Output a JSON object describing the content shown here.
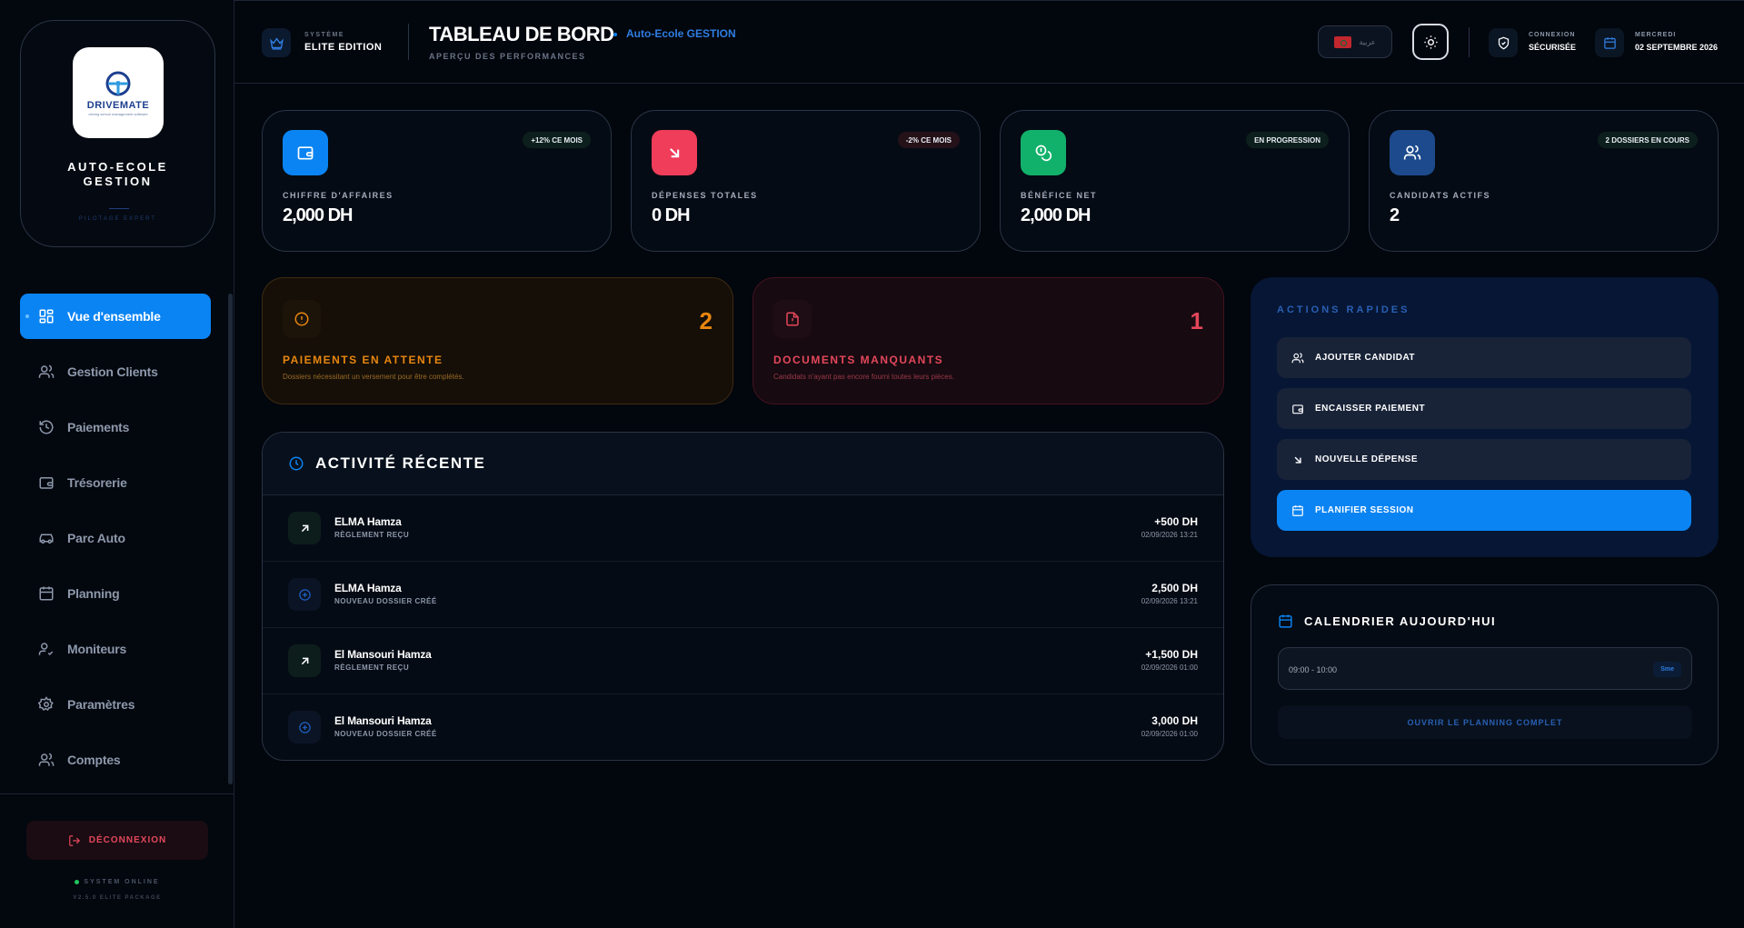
{
  "sidebar": {
    "brand": {
      "logo_text": "DRIVEMATE",
      "logo_subtext": "driving school management software",
      "title_line1": "AUTO-ECOLE",
      "title_line2": "GESTION",
      "tagline": "PILOTAGE EXPERT"
    },
    "nav": [
      {
        "label": "Vue d'ensemble",
        "icon": "grid-icon",
        "active": true
      },
      {
        "label": "Gestion Clients",
        "icon": "users-icon",
        "active": false
      },
      {
        "label": "Paiements",
        "icon": "history-icon",
        "active": false
      },
      {
        "label": "Trésorerie",
        "icon": "wallet-icon",
        "active": false
      },
      {
        "label": "Parc Auto",
        "icon": "car-icon",
        "active": false
      },
      {
        "label": "Planning",
        "icon": "calendar-icon",
        "active": false
      },
      {
        "label": "Moniteurs",
        "icon": "user-check-icon",
        "active": false
      },
      {
        "label": "Paramètres",
        "icon": "gear-icon",
        "active": false
      },
      {
        "label": "Comptes",
        "icon": "users-icon",
        "active": false
      }
    ],
    "logout_label": "DÉCONNEXION",
    "status": "SYSTEM ONLINE",
    "version": "V2.5.0 ELITE PACKAGE"
  },
  "header": {
    "system_label": "SYSTÈME",
    "system_value": "ELITE EDITION",
    "title": "TABLEAU DE BORD",
    "crumb": "Auto-Ecole GESTION",
    "subtitle": "APERÇU DES PERFORMANCES",
    "language": "عربية",
    "connection_label": "CONNEXION",
    "connection_value": "SÉCURISÉE",
    "day_label": "MERCREDI",
    "date_value": "02 SEPTEMBRE 2026"
  },
  "kpis": [
    {
      "label": "CHIFFRE D'AFFAIRES",
      "value": "2,000 DH",
      "badge": "+12% CE MOIS",
      "icon": "wallet-icon",
      "color": "#0b84f3"
    },
    {
      "label": "DÉPENSES TOTALES",
      "value": "0 DH",
      "badge": "-2% CE MOIS",
      "icon": "arrow-down-right-icon",
      "color": "#ef3d5a"
    },
    {
      "label": "BÉNÉFICE NET",
      "value": "2,000 DH",
      "badge": "EN PROGRESSION",
      "icon": "coins-icon",
      "color": "#12b16b"
    },
    {
      "label": "CANDIDATS ACTIFS",
      "value": "2",
      "badge": "2 DOSSIERS EN COURS",
      "icon": "users-icon",
      "color": "#1c4a8c"
    }
  ],
  "alerts": [
    {
      "count": "2",
      "title": "PAIEMENTS EN ATTENTE",
      "desc": "Dossiers nécessitant un versement pour être complétés.",
      "icon": "alert-circle-icon"
    },
    {
      "count": "1",
      "title": "DOCUMENTS MANQUANTS",
      "desc": "Candidats n'ayant pas encore fourni toutes leurs pièces.",
      "icon": "file-alert-icon"
    }
  ],
  "activity": {
    "title": "ACTIVITÉ RÉCENTE",
    "rows": [
      {
        "name": "ELMA Hamza",
        "type": "RÈGLEMENT REÇU",
        "amount": "+500 DH",
        "date": "02/09/2026 13:21",
        "icon": "arrow-up-right-icon"
      },
      {
        "name": "ELMA Hamza",
        "type": "NOUVEAU DOSSIER CRÉÉ",
        "amount": "2,500 DH",
        "date": "02/09/2026 13:21",
        "icon": "plus-circle-icon"
      },
      {
        "name": "El Mansouri Hamza",
        "type": "RÈGLEMENT REÇU",
        "amount": "+1,500 DH",
        "date": "02/09/2026 01:00",
        "icon": "arrow-up-right-icon"
      },
      {
        "name": "El Mansouri Hamza",
        "type": "NOUVEAU DOSSIER CRÉÉ",
        "amount": "3,000 DH",
        "date": "02/09/2026 01:00",
        "icon": "plus-circle-icon"
      }
    ]
  },
  "quick_actions": {
    "title": "ACTIONS RAPIDES",
    "buttons": [
      {
        "label": "AJOUTER CANDIDAT",
        "icon": "users-icon"
      },
      {
        "label": "ENCAISSER PAIEMENT",
        "icon": "wallet-icon"
      },
      {
        "label": "NOUVELLE DÉPENSE",
        "icon": "arrow-down-right-icon"
      },
      {
        "label": "PLANIFIER SESSION",
        "icon": "calendar-icon"
      }
    ]
  },
  "calendar": {
    "title": "CALENDRIER AUJOURD'HUI",
    "slot_time": "09:00 - 10:00",
    "slot_tag": "Sme",
    "link": "OUVRIR LE PLANNING COMPLET"
  },
  "colors": {
    "accent": "#0b84f3",
    "danger": "#e4475b",
    "warning": "#e8860f",
    "success": "#12b16b",
    "background": "#02060d"
  }
}
